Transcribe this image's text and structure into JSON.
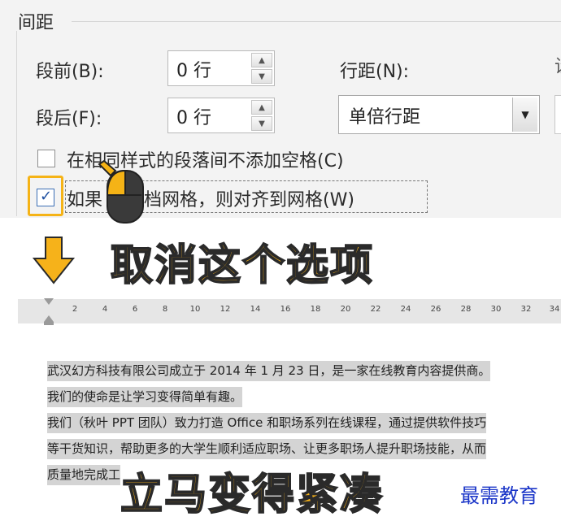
{
  "dialog": {
    "group_title": "间距",
    "before_label": "段前(B):",
    "before_value": "0 行",
    "after_label": "段后(F):",
    "after_value": "0 行",
    "line_spacing_label": "行距(N):",
    "line_spacing_value": "单倍行距",
    "cb_no_space_label": "在相同样式的段落间不添加空格(C)",
    "cb_no_space_checked": false,
    "cb_grid_label": "如果定义了文档网格，则对齐到网格(W)",
    "cb_grid_label_visible": "如果    了文档网格，则对齐到网格(W)",
    "cb_grid_checked": true,
    "edge_text": "设"
  },
  "captions": {
    "cancel_option": "取消这个选项",
    "becomes_compact": "立马变得紧凑"
  },
  "ruler": {
    "ticks": [
      "2",
      "4",
      "6",
      "8",
      "10",
      "12",
      "14",
      "16",
      "18",
      "20",
      "22",
      "24",
      "26",
      "28",
      "30",
      "32",
      "34"
    ]
  },
  "document": {
    "lines": [
      "武汉幻方科技有限公司成立于 2014 年 1 月 23 日，是一家在线教育内容提供商。",
      "我们的使命是让学习变得简单有趣。",
      "我们（秋叶 PPT 团队）致力打造 Office 和职场系列在线课程，通过提供软件技巧",
      "等干货知识，帮助更多的大学生顺利适应职场、让更多职场人提升职场技能，从而",
      "质量地完成工"
    ]
  },
  "watermark": "最需教育",
  "colors": {
    "highlight": "#f5b316",
    "caption_fill": "#f6b21a",
    "watermark": "#1a35c8"
  }
}
